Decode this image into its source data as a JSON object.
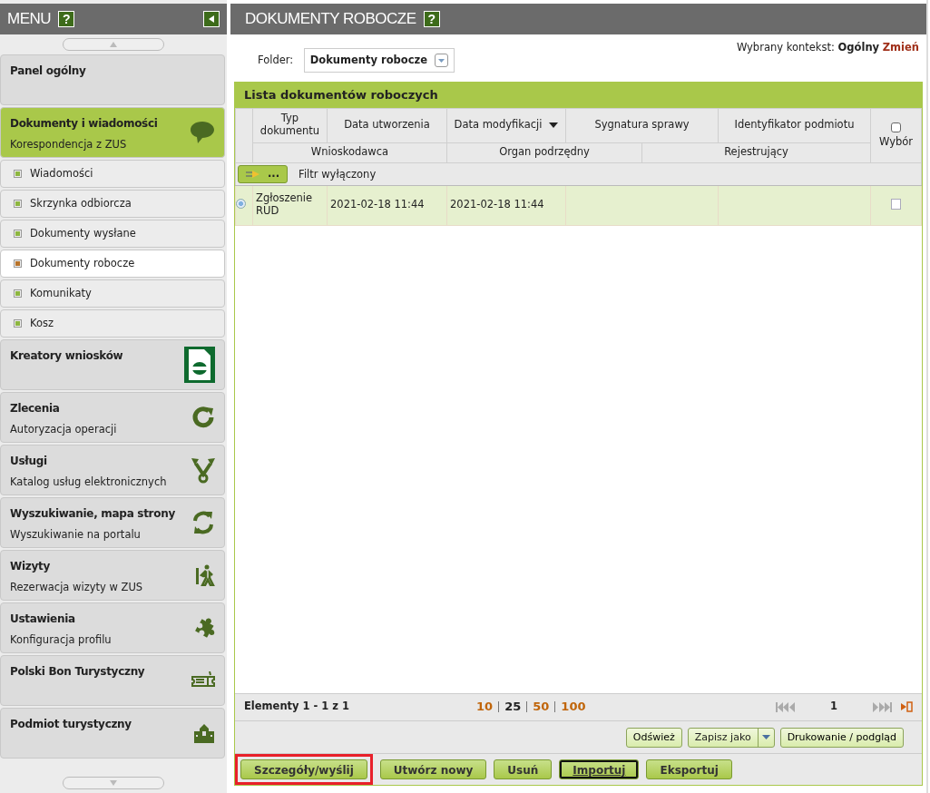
{
  "menu": {
    "title": "MENU",
    "help": "?",
    "items": [
      {
        "kind": "section",
        "title": "Panel ogólny",
        "selected": false
      },
      {
        "kind": "section",
        "title": "Dokumenty i wiadomości",
        "subtitle": "Korespondencja z ZUS",
        "selected": true
      },
      {
        "kind": "sub",
        "label": "Wiadomości",
        "selected": false
      },
      {
        "kind": "sub",
        "label": "Skrzynka odbiorcza",
        "selected": false
      },
      {
        "kind": "sub",
        "label": "Dokumenty wysłane",
        "selected": false
      },
      {
        "kind": "sub",
        "label": "Dokumenty robocze",
        "selected": true
      },
      {
        "kind": "sub",
        "label": "Komunikaty",
        "selected": false
      },
      {
        "kind": "sub",
        "label": "Kosz",
        "selected": false
      },
      {
        "kind": "section",
        "title": "Kreatory wniosków",
        "selected": false
      },
      {
        "kind": "section",
        "title": "Zlecenia",
        "subtitle": "Autoryzacja operacji",
        "selected": false
      },
      {
        "kind": "section",
        "title": "Usługi",
        "subtitle": "Katalog usług elektronicznych",
        "selected": false
      },
      {
        "kind": "section",
        "title": "Wyszukiwanie, mapa strony",
        "subtitle": "Wyszukiwanie na portalu",
        "selected": false
      },
      {
        "kind": "section",
        "title": "Wizyty",
        "subtitle": "Rezerwacja wizyty w ZUS",
        "selected": false
      },
      {
        "kind": "section",
        "title": "Ustawienia",
        "subtitle": "Konfiguracja profilu",
        "selected": false
      },
      {
        "kind": "section",
        "title": "Polski Bon Turystyczny",
        "selected": false
      },
      {
        "kind": "section",
        "title": "Podmiot turystyczny",
        "selected": false
      }
    ]
  },
  "page": {
    "title": "DOKUMENTY ROBOCZE",
    "help": "?",
    "folder": {
      "label": "Folder:",
      "value": "Dokumenty robocze"
    },
    "context": {
      "label": "Wybrany kontekst:",
      "value": "Ogólny",
      "link": "Zmień"
    },
    "panel_title": "Lista dokumentów roboczych",
    "columns": [
      {
        "label": "Typ dokumentu",
        "sorted": false
      },
      {
        "label": "Data utworzenia",
        "sorted": false
      },
      {
        "label": "Data modyfikacji",
        "sorted": true
      },
      {
        "label": "Sygnatura sprawy",
        "sorted": false
      },
      {
        "label": "Identyfikator podmiotu",
        "sorted": false
      }
    ],
    "sub_columns": [
      "Wnioskodawca",
      "Organ podrzędny",
      "Rejestrujący"
    ],
    "select_column": {
      "label": "Wybór",
      "checked": false
    },
    "filter": {
      "button": "...",
      "text": "Filtr wyłączony"
    },
    "rows": [
      {
        "selected": true,
        "checked": false,
        "cells": [
          "Zgłoszenie RUD",
          "2021-02-18 11:44",
          "2021-02-18 11:44"
        ]
      }
    ],
    "pager": {
      "summary": "Elementy 1 - 1 z 1",
      "page_sizes": [
        {
          "label": "10",
          "selected": false
        },
        {
          "label": "25",
          "selected": true
        },
        {
          "label": "50",
          "selected": false
        },
        {
          "label": "100",
          "selected": false
        }
      ],
      "page": "1"
    },
    "tools": [
      {
        "kind": "plain",
        "label": "Odśwież"
      },
      {
        "kind": "split",
        "label": "Zapisz jako"
      },
      {
        "kind": "plain",
        "label": "Drukowanie / podgląd"
      }
    ],
    "actions": [
      {
        "label": "Szczegóły/wyślij",
        "focused": false,
        "highlighted": true
      },
      {
        "label": "Utwórz nowy",
        "focused": false,
        "highlighted": false
      },
      {
        "label": "Usuń",
        "focused": false,
        "highlighted": false
      },
      {
        "label": "Importuj",
        "focused": true,
        "highlighted": false
      },
      {
        "label": "Eksportuj",
        "focused": false,
        "highlighted": false
      }
    ]
  }
}
